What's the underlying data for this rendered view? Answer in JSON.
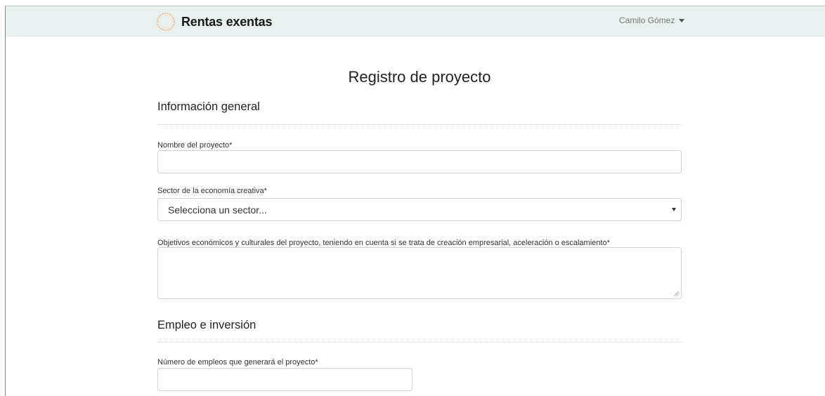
{
  "navbar": {
    "brand_name": "Rentas exentas",
    "user_name": "Camilo Gómez"
  },
  "page": {
    "title": "Registro de proyecto"
  },
  "sections": [
    {
      "title": "Información general",
      "fields": [
        {
          "label": "Nombre del proyecto*",
          "value": "",
          "placeholder": ""
        },
        {
          "label": "Sector de la economía creativa*",
          "selected": "Selecciona un sector..."
        },
        {
          "label": "Objetivos económicos y culturales del proyecto, teniendo en cuenta si se trata de creación empresarial, aceleración o escalamiento*",
          "value": ""
        }
      ]
    },
    {
      "title": "Empleo e inversión",
      "fields": [
        {
          "label": "Número de empleos que generará el proyecto*",
          "value": ""
        }
      ]
    }
  ],
  "colors": {
    "navbar_bg": "#e8f1ef",
    "logo_accent": "#f0a36a"
  },
  "icons": {
    "brand_logo": "circular-seal-logo",
    "user_menu": "caret-down-icon",
    "select": "caret-down-icon"
  }
}
